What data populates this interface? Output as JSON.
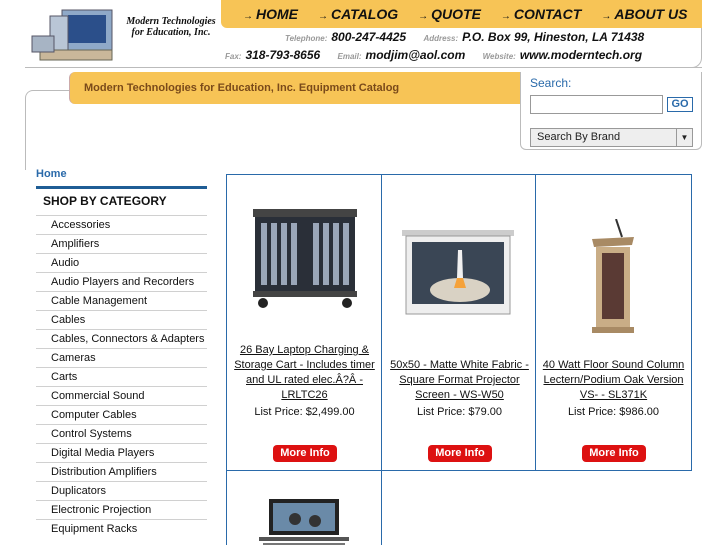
{
  "header": {
    "company_name": "Modern Technologies for Education, Inc.",
    "nav": [
      {
        "label": "HOME"
      },
      {
        "label": "CATALOG"
      },
      {
        "label": "QUOTE"
      },
      {
        "label": "CONTACT"
      },
      {
        "label": "ABOUT US"
      }
    ],
    "telephone_label": "Telephone:",
    "telephone": "800-247-4425",
    "address_label": "Address:",
    "address": "P.O. Box 99, Hineston, LA 71438",
    "fax_label": "Fax:",
    "fax": "318-793-8656",
    "email_label": "Email:",
    "email": "modjim@aol.com",
    "website_label": "Website:",
    "website": "www.moderntech.org"
  },
  "catalog_title": "Modern Technologies for Education, Inc. Equipment Catalog",
  "search": {
    "label": "Search:",
    "value": "",
    "go_label": "GO",
    "brand_select": "Search By Brand"
  },
  "sidebar": {
    "home": "Home",
    "title": "SHOP BY CATEGORY",
    "categories": [
      "Accessories",
      "Amplifiers",
      "Audio",
      "Audio Players and Recorders",
      "Cable Management",
      "Cables",
      "Cables, Connectors & Adapters",
      "Cameras",
      "Carts",
      "Commercial Sound",
      "Computer Cables",
      "Control Systems",
      "Digital Media Players",
      "Distribution Amplifiers",
      "Duplicators",
      "Electronic Projection",
      "Equipment Racks"
    ]
  },
  "products": [
    {
      "name": "26 Bay Laptop Charging & Storage Cart - Includes timer and UL rated elec.Â?Â  - LRLTC26",
      "price": "List Price: $2,499.00",
      "button": "More Info"
    },
    {
      "name": "50x50 - Matte White Fabric - Square Format Projector Screen - WS-W50",
      "price": "List Price: $79.00",
      "button": "More Info"
    },
    {
      "name": "40 Watt Floor Sound Column Lectern/Podium Oak Version VS- - SL371K",
      "price": "List Price: $986.00",
      "button": "More Info"
    }
  ],
  "colors": {
    "accent": "#f7c456",
    "link": "#2a6aaa",
    "button": "#dd1111"
  }
}
